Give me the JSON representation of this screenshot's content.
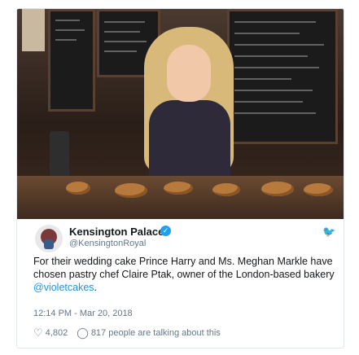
{
  "tweet": {
    "author_name": "Kensington Palace",
    "author_handle": "@KensingtonRoyal",
    "text_main": "For their wedding cake Prince Harry and Ms. Meghan Markle have chosen pastry chef Claire Ptak, owner of the London-based bakery ",
    "text_link": "@violetcakes",
    "text_end": ".",
    "timestamp": "12:14 PM - Mar 20, 2018",
    "likes": "4,802",
    "comments": "817 people are talking about this"
  },
  "icons": {
    "verified": "verified-badge-icon",
    "bird": "twitter-bird-icon",
    "heart": "heart-icon",
    "comment": "comment-bubble-icon"
  },
  "colors": {
    "accent": "#1da1f2",
    "link": "#1b95e0",
    "muted": "#657786",
    "text": "#14171a"
  }
}
